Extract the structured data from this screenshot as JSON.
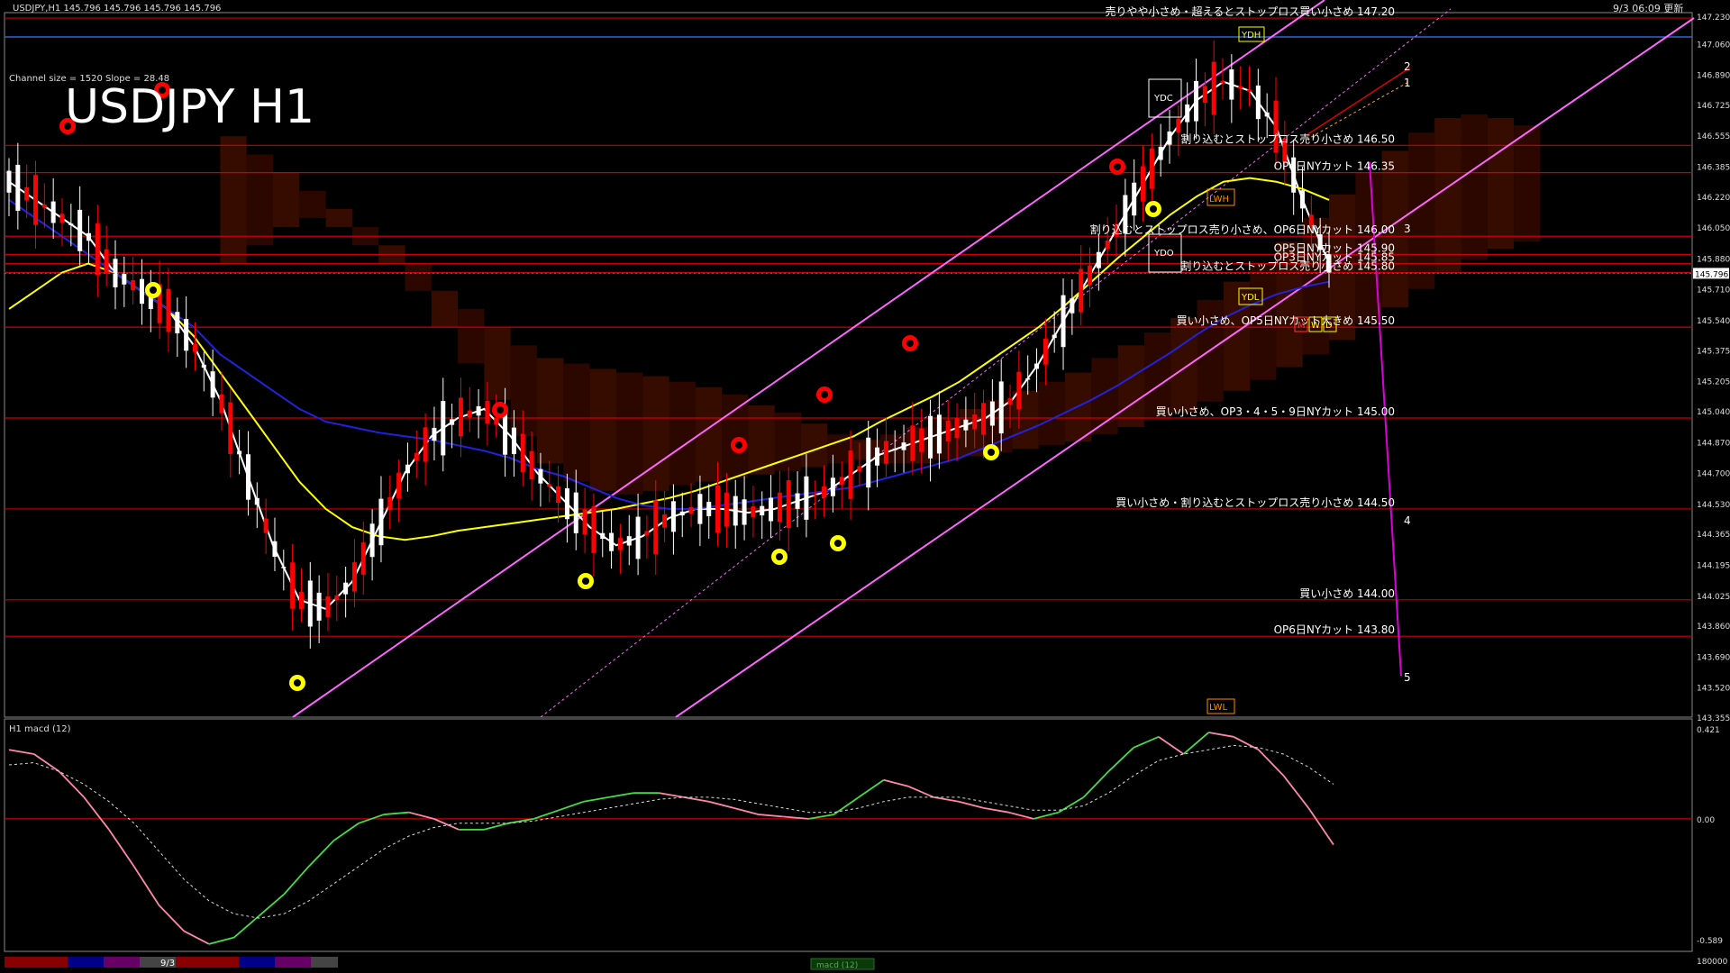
{
  "header": {
    "symbol_line": "USDJPY,H1  145.796 145.796 145.796 145.796",
    "clock": "9/3 06:09 更新",
    "big_title": "USDJPY H1",
    "channel_info": "Channel size = 1520 Slope = 28.48"
  },
  "colors": {
    "background": "#000000",
    "bull_candle": "#ffffff",
    "bear_candle": "#ff0000",
    "level_line": "#cc0000",
    "channel": "#ff66ff",
    "ma_fast": "#ffffff",
    "ma_mid": "#ffff00",
    "ma_slow": "#2222dd",
    "chikou": "#22aa22",
    "kumo": "#aa2200",
    "macd_up": "#44dd44",
    "macd_down": "#ff88aa"
  },
  "price_axis": {
    "ticks": [
      "147.230",
      "147.060",
      "146.890",
      "146.725",
      "146.555",
      "146.385",
      "146.220",
      "146.050",
      "145.880",
      "145.710",
      "145.540",
      "145.375",
      "145.205",
      "145.040",
      "144.870",
      "144.700",
      "144.530",
      "144.365",
      "144.195",
      "144.025",
      "143.860",
      "143.690",
      "143.520",
      "143.355"
    ],
    "current": "145.796"
  },
  "macd_panel": {
    "label": "H1  macd (12)",
    "ticks": [
      "0.421",
      "0.00",
      "-0.589",
      "180000"
    ]
  },
  "bottom_bar": {
    "date": "9/3",
    "tab": "macd (12)"
  },
  "markers": {
    "box_labels": [
      "YDH",
      "YDC",
      "YDO",
      "YDL",
      "LWH",
      "LWL"
    ],
    "mwd": [
      "M",
      "W",
      "D"
    ],
    "wave_numbers": [
      "2",
      "1",
      "3",
      "4",
      "5"
    ]
  },
  "chart_data": {
    "type": "line",
    "title": "USDJPY H1",
    "ylim": [
      143.355,
      147.23
    ],
    "levels": [
      {
        "price": 147.2,
        "label": "売りやや小さめ・超えるとストップロス買い小さめ 147.20"
      },
      {
        "price": 146.5,
        "label": "割り込むとストップロス売り小さめ 146.50"
      },
      {
        "price": 146.35,
        "label": "OP4日NYカット 146.35"
      },
      {
        "price": 146.0,
        "label": "割り込むとストップロス売り小さめ、OP6日NYカット 146.00"
      },
      {
        "price": 145.9,
        "label": "OP5日NYカット 145.90"
      },
      {
        "price": 145.85,
        "label": "OP3日NYカット 145.85"
      },
      {
        "price": 145.8,
        "label": "割り込むとストップロス売り小さめ 145.80"
      },
      {
        "price": 145.5,
        "label": "買い小さめ、OP5日NYカット大きめ 145.50"
      },
      {
        "price": 145.0,
        "label": "買い小さめ、OP3・4・5・9日NYカット 145.00"
      },
      {
        "price": 144.5,
        "label": "買い小さめ・割り込むとストップロス売り小さめ 144.50"
      },
      {
        "price": 144.0,
        "label": "買い小さめ 144.00"
      },
      {
        "price": 143.8,
        "label": "OP6日NYカット 143.80"
      }
    ],
    "series": [
      {
        "values": [
          146.3,
          146.2,
          146.1,
          146.0,
          145.8,
          145.7,
          145.6,
          145.4,
          145.1,
          144.7,
          144.3,
          144.0,
          143.95,
          144.1,
          144.4,
          144.7,
          144.9,
          145.0,
          145.05,
          144.9,
          144.7,
          144.55,
          144.4,
          144.3,
          144.35,
          144.45,
          144.5,
          144.5,
          144.48,
          144.5,
          144.55,
          144.6,
          144.7,
          144.8,
          144.85,
          144.9,
          144.95,
          145.0,
          145.1,
          145.3,
          145.55,
          145.8,
          146.05,
          146.3,
          146.55,
          146.75,
          146.85,
          146.8,
          146.6,
          146.2,
          145.85
        ]
      },
      {
        "values": [
          145.6,
          145.7,
          145.8,
          145.85,
          145.8,
          145.7,
          145.6,
          145.45,
          145.25,
          145.05,
          144.85,
          144.65,
          144.5,
          144.4,
          144.35,
          144.33,
          144.35,
          144.38,
          144.4,
          144.42,
          144.44,
          144.46,
          144.48,
          144.5,
          144.53,
          144.56,
          144.6,
          144.65,
          144.7,
          144.75,
          144.8,
          144.85,
          144.9,
          144.98,
          145.05,
          145.12,
          145.2,
          145.3,
          145.4,
          145.5,
          145.62,
          145.75,
          145.88,
          146.0,
          146.12,
          146.22,
          146.3,
          146.32,
          146.3,
          146.26,
          146.2
        ]
      },
      {
        "values": [
          146.2,
          146.1,
          146.0,
          145.9,
          145.8,
          145.7,
          145.6,
          145.5,
          145.35,
          145.25,
          145.15,
          145.05,
          144.98,
          144.95,
          144.92,
          144.9,
          144.88,
          144.85,
          144.82,
          144.78,
          144.72,
          144.68,
          144.62,
          144.56,
          144.52,
          144.5,
          144.5,
          144.52,
          144.54,
          144.56,
          144.58,
          144.6,
          144.62,
          144.66,
          144.7,
          144.74,
          144.78,
          144.84,
          144.9,
          144.96,
          145.03,
          145.1,
          145.18,
          145.27,
          145.36,
          145.46,
          145.55,
          145.62,
          145.68,
          145.72,
          145.75
        ]
      },
      {
        "values": [
          null,
          null,
          null,
          null,
          null,
          null,
          null,
          null,
          null,
          null,
          null,
          null,
          null,
          null,
          null,
          null,
          null,
          null,
          null,
          null,
          null,
          null,
          null,
          null,
          null,
          null,
          null,
          null,
          null,
          null,
          null,
          null,
          null,
          null,
          null,
          null,
          null,
          null,
          null,
          null,
          null,
          null,
          null,
          null,
          null,
          null,
          null,
          null,
          null,
          null,
          null
        ]
      }
    ],
    "macd": {
      "main": [
        0.32,
        0.3,
        0.22,
        0.1,
        -0.05,
        -0.22,
        -0.4,
        -0.52,
        -0.58,
        -0.55,
        -0.45,
        -0.35,
        -0.22,
        -0.1,
        -0.02,
        0.02,
        0.03,
        0.0,
        -0.05,
        -0.05,
        -0.02,
        0.0,
        0.04,
        0.08,
        0.1,
        0.12,
        0.12,
        0.1,
        0.08,
        0.05,
        0.02,
        0.01,
        0.0,
        0.02,
        0.1,
        0.18,
        0.15,
        0.1,
        0.08,
        0.05,
        0.03,
        0.0,
        0.03,
        0.1,
        0.22,
        0.33,
        0.38,
        0.3,
        0.4,
        0.38,
        0.32,
        0.2,
        0.05,
        -0.12
      ],
      "signal": [
        0.25,
        0.26,
        0.22,
        0.16,
        0.08,
        -0.02,
        -0.15,
        -0.28,
        -0.38,
        -0.44,
        -0.46,
        -0.44,
        -0.38,
        -0.3,
        -0.22,
        -0.14,
        -0.08,
        -0.04,
        -0.02,
        -0.02,
        -0.02,
        -0.01,
        0.01,
        0.03,
        0.05,
        0.07,
        0.09,
        0.1,
        0.1,
        0.09,
        0.07,
        0.05,
        0.03,
        0.03,
        0.05,
        0.08,
        0.1,
        0.1,
        0.1,
        0.08,
        0.06,
        0.04,
        0.04,
        0.06,
        0.12,
        0.2,
        0.27,
        0.3,
        0.32,
        0.34,
        0.33,
        0.3,
        0.24,
        0.16
      ],
      "ylim": [
        -0.589,
        0.421
      ]
    }
  }
}
